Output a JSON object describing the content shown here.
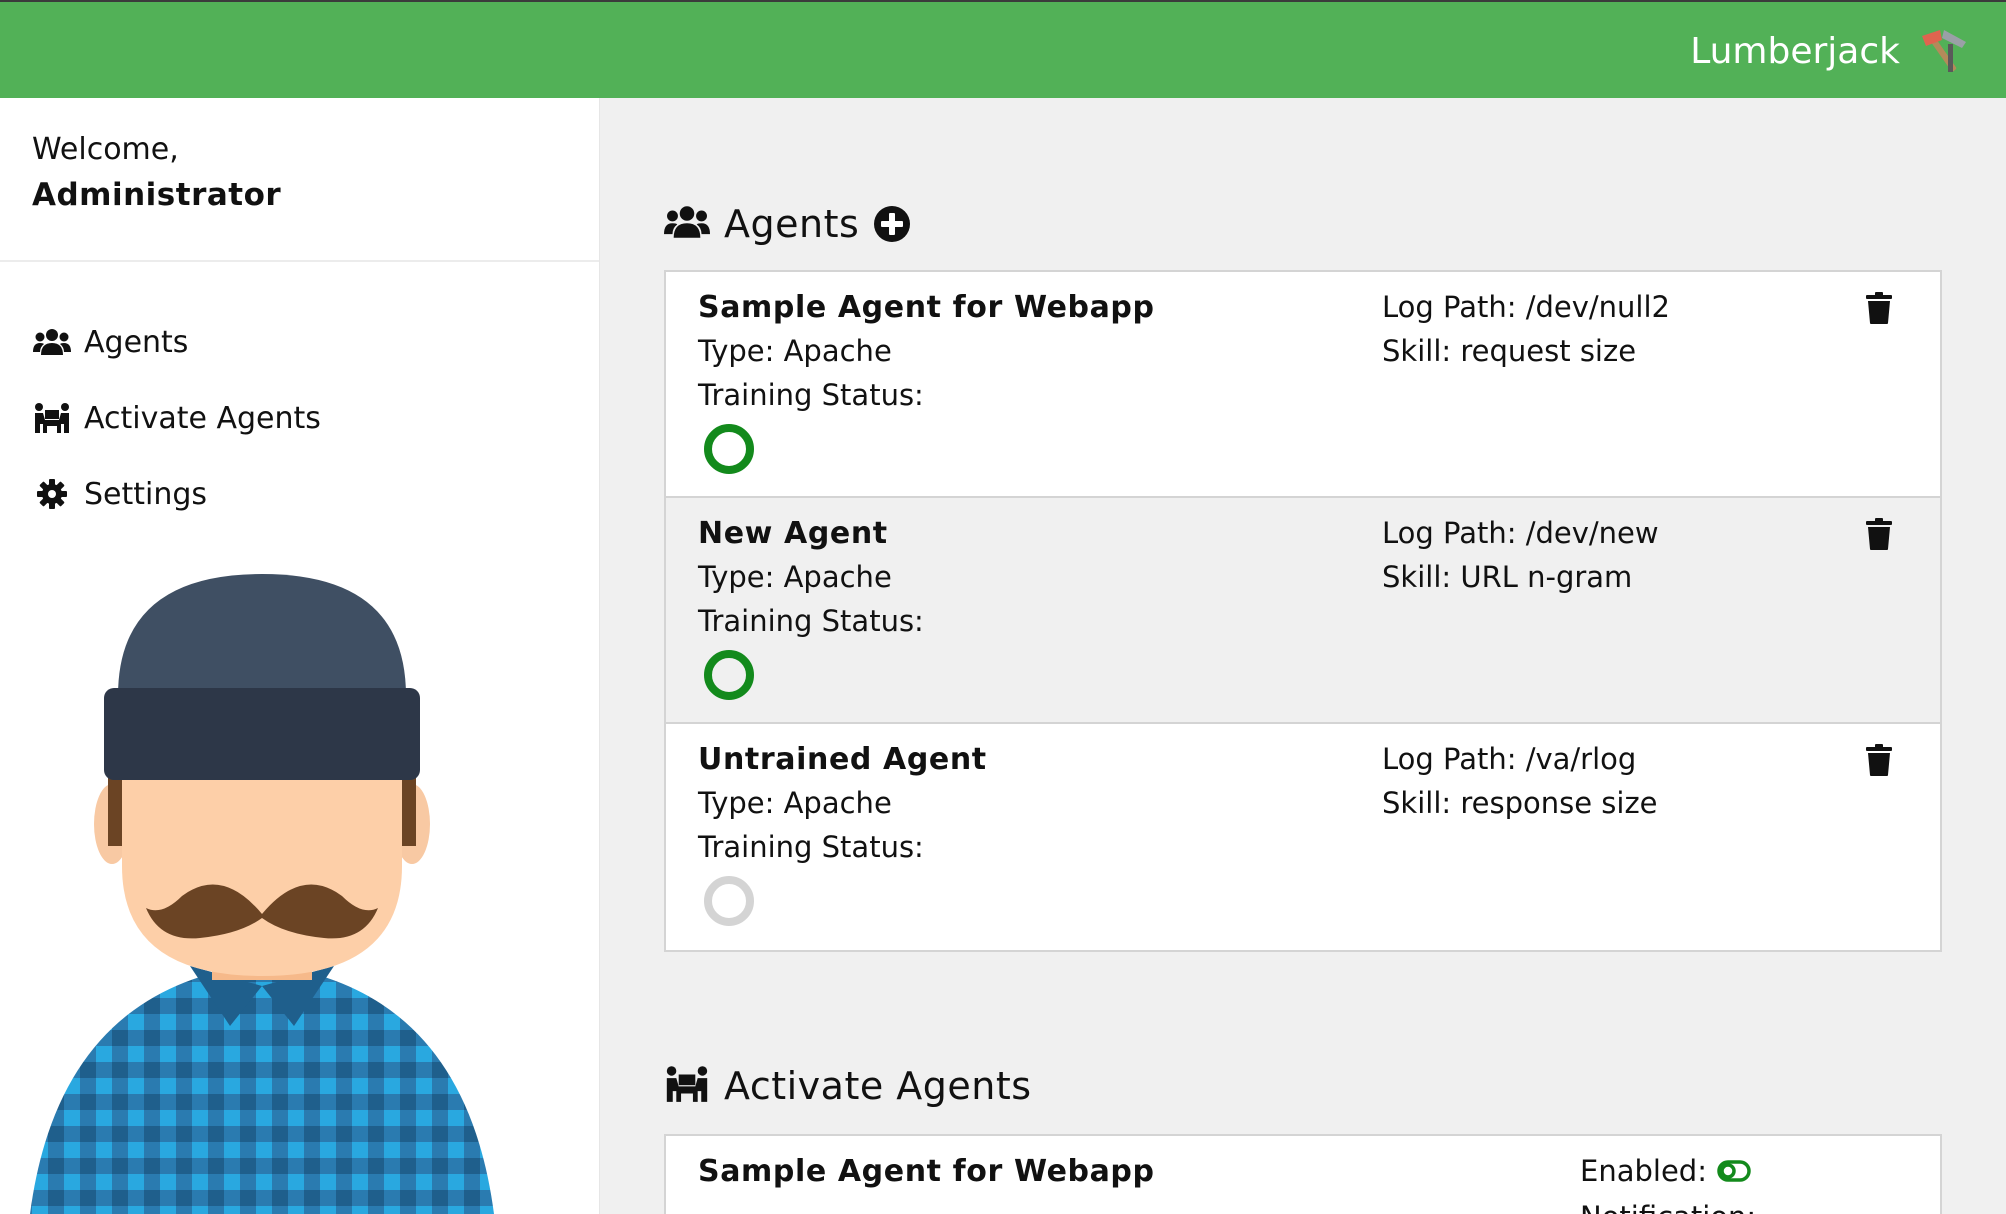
{
  "header": {
    "brand": "Lumberjack",
    "brand_color": "#52b157"
  },
  "sidebar": {
    "welcome_line": "Welcome,",
    "user_name": "Administrator",
    "items": [
      {
        "label": "Agents",
        "icon": "users-icon"
      },
      {
        "label": "Activate Agents",
        "icon": "people-carry-icon"
      },
      {
        "label": "Settings",
        "icon": "gear-icon"
      }
    ]
  },
  "agents_section": {
    "title": "Agents",
    "icon": "users-icon",
    "add_icon": "plus-circle-icon",
    "agents": [
      {
        "name": "Sample Agent for Webapp",
        "type": "Type: Apache",
        "status_label": "Training Status:",
        "status": "trained",
        "log_path": "Log Path: /dev/null2",
        "skill": "Skill: request size"
      },
      {
        "name": "New Agent",
        "type": "Type: Apache",
        "status_label": "Training Status:",
        "status": "trained",
        "log_path": "Log Path: /dev/new",
        "skill": "Skill: URL n-gram"
      },
      {
        "name": "Untrained Agent",
        "type": "Type: Apache",
        "status_label": "Training Status:",
        "status": "untrained",
        "log_path": "Log Path: /va/rlog",
        "skill": "Skill: response size"
      }
    ]
  },
  "activate_section": {
    "title": "Activate Agents",
    "icon": "people-carry-icon",
    "agents": [
      {
        "name": "Sample Agent for Webapp",
        "enabled_label": "Enabled:",
        "enabled": true,
        "notification_label": "Notification:"
      }
    ]
  },
  "colors": {
    "status_trained": "#138a1c",
    "status_untrained": "#d4d4d4",
    "toggle_on": "#138a1c"
  }
}
